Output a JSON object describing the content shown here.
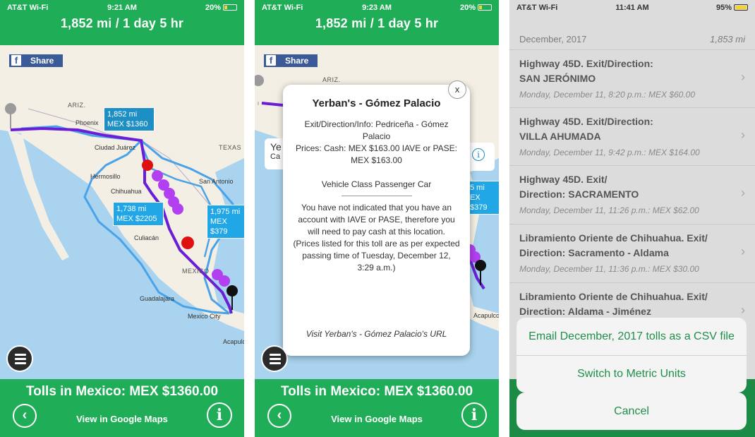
{
  "status_bar": {
    "carrier": "AT&T Wi-Fi",
    "times": [
      "9:21 AM",
      "9:23 AM",
      "11:41 AM"
    ],
    "battery": [
      "20%",
      "20%",
      "95%"
    ]
  },
  "route_summary": "1,852 mi / 1 day 5 hr",
  "facebook": {
    "icon_letter": "f",
    "label": "Share"
  },
  "map": {
    "regions": [
      "ARIZ.",
      "TEXAS",
      "MEXICO"
    ],
    "cities": [
      "Phoenix",
      "Ciudad Juárez",
      "Hermosillo",
      "Chihuahua",
      "San Antonio",
      "Culiacán",
      "Guadalajara",
      "Mexico City",
      "Acapulco"
    ],
    "callouts": {
      "main": [
        "1,852 mi",
        "MEX $1360"
      ],
      "alt1": [
        "1,738 mi",
        "MEX $2205"
      ],
      "alt2": [
        "1,975 mi",
        "MEX $379"
      ],
      "s2_partial": [
        "5 mi",
        "EX $379"
      ]
    }
  },
  "tolls_summary": "Tolls in Mexico: MEX $1360.00",
  "google_maps_link": "View in Google Maps",
  "popup": {
    "title": "Yerban's - Gómez Palacio",
    "close": "x",
    "exit_info": "Exit/Direction/Info: Pedriceña - Gómez Palacio",
    "prices": "Prices: Cash: MEX $163.00 IAVE or PASE: MEX $163.00",
    "vehicle_class": "Vehicle Class Passenger Car",
    "warning": "You have not indicated that you have an account with IAVE or PASE, therefore you will need to pay cash at this location.",
    "note": "(Prices listed for this toll are as per expected passing time of Tuesday, December 12, 3:29 a.m.)",
    "url_link": "Visit Yerban's - Gómez Palacio's URL",
    "bg_peek": [
      "Ye",
      "Ca"
    ]
  },
  "toll_list": {
    "month": "December, 2017",
    "total_distance": "1,853 mi",
    "items": [
      {
        "name_lines": [
          "Highway 45D. Exit/Direction:",
          "SAN JERÓNIMO"
        ],
        "meta": "Monday, December 11, 8:20 p.m.: MEX $60.00"
      },
      {
        "name_lines": [
          "Highway 45D. Exit/Direction:",
          "VILLA AHUMADA"
        ],
        "meta": "Monday, December 11, 9:42 p.m.: MEX $164.00"
      },
      {
        "name_lines": [
          "Highway 45D. Exit/",
          "Direction: SACRAMENTO"
        ],
        "meta": "Monday, December 11, 11:26 p.m.: MEX $62.00"
      },
      {
        "name_lines": [
          "Libramiento Oriente de Chihuahua. Exit/",
          "Direction: Sacramento - Aldama"
        ],
        "meta": "Monday, December 11, 11:36 p.m.: MEX $30.00"
      },
      {
        "name_lines": [
          "Libramiento Oriente de Chihuahua. Exit/",
          "Direction: Aldama - Jiménez"
        ],
        "meta": ""
      }
    ]
  },
  "action_sheet": {
    "email_csv": "Email December, 2017 tolls as a CSV file",
    "metric_units": "Switch to Metric Units",
    "cancel": "Cancel"
  },
  "colors": {
    "brand_green": "#1fae57",
    "route_main": "#6a1fd6",
    "route_alt": "#4aa3e8",
    "marker_toll": "#a020f0",
    "marker_alert": "#e01010"
  }
}
